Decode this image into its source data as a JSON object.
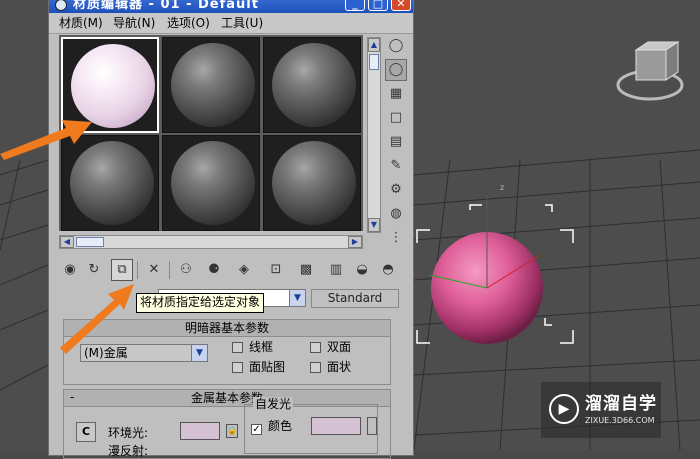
{
  "window": {
    "title": "材质编辑器 - 01 - Default",
    "controls": {
      "min": "_",
      "max": "□",
      "close": "✕"
    }
  },
  "menu": [
    "材质(M)",
    "导航(N)",
    "选项(O)",
    "工具(U)"
  ],
  "sample_slots": {
    "count": 6,
    "active_index": 0
  },
  "tooltip": "将材质指定给选定对象",
  "material_type": "Standard",
  "shader_panel": {
    "title": "明暗器基本参数",
    "shader": "(M)金属",
    "options": [
      {
        "label": "线框",
        "checked": false
      },
      {
        "label": "双面",
        "checked": false
      },
      {
        "label": "面贴图",
        "checked": false
      },
      {
        "label": "面状",
        "checked": false
      }
    ]
  },
  "metal_panel": {
    "title": "金属基本参数",
    "ambient_label": "环境光:",
    "diffuse_label": "漫反射:",
    "self_illum": {
      "label": "自发光",
      "color_label": "颜色",
      "checked": true
    },
    "lock_label": "C"
  },
  "viewport": {
    "axis_label": "z",
    "sphere_color": "#e0609a"
  },
  "watermark": {
    "logo": "▶",
    "title": "溜溜自学",
    "subtitle": "ZIXUE.3D66.COM"
  },
  "colors": {
    "accent": "#1d4fb8",
    "arrow": "#f07a1e",
    "sphere": "#e0609a"
  }
}
